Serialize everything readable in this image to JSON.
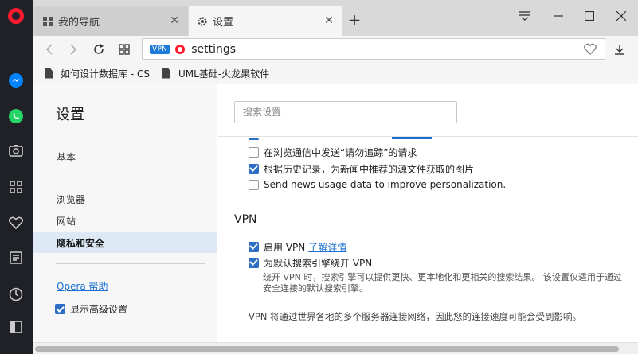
{
  "tabs": [
    {
      "label": "我的导航",
      "icon": "grid-icon"
    },
    {
      "label": "设置",
      "icon": "gear-icon"
    }
  ],
  "toolbar": {
    "vpn_badge": "VPN",
    "address_text": "settings"
  },
  "bookmarks": [
    {
      "label": "如何设计数据库 - CS"
    },
    {
      "label": "UML基础-火龙果软件"
    }
  ],
  "sidebar": {
    "title": "设置",
    "items": [
      {
        "label": "基本"
      },
      {
        "label": "浏览器"
      },
      {
        "label": "网站"
      },
      {
        "label": "隐私和安全"
      }
    ],
    "help_link": "Opera 帮助",
    "advanced_label": "显示高级设置",
    "advanced_checked": true
  },
  "main": {
    "search_placeholder": "搜索设置",
    "privacy_rows": [
      {
        "label": "在浏览通信中发送“请勿追踪”的请求",
        "checked": false
      },
      {
        "label": "根据历史记录，为新闻中推荐的源文件获取的图片",
        "checked": true
      },
      {
        "label": "Send news usage data to improve personalization.",
        "checked": false
      }
    ],
    "vpn_heading": "VPN",
    "vpn_enable_label": "启用 VPN",
    "vpn_learn_more": "了解详情",
    "vpn_enable_checked": true,
    "vpn_bypass_label": "为默认搜索引擎绕开 VPN",
    "vpn_bypass_checked": true,
    "vpn_bypass_desc": "绕开 VPN 时，搜索引擎可以提供更快、更本地化和更相关的搜索结果。 该设置仅适用于通过安全连接的默认搜索引擎。",
    "vpn_note": "VPN 将通过世界各地的多个服务器连接网络，因此您的连接速度可能会受到影响。"
  },
  "colors": {
    "brand_red": "#ff1b2d",
    "accent_blue": "#2d6fc4",
    "rail_dark": "#1f2126",
    "messenger_blue": "#0084ff",
    "whatsapp_green": "#25d366"
  }
}
